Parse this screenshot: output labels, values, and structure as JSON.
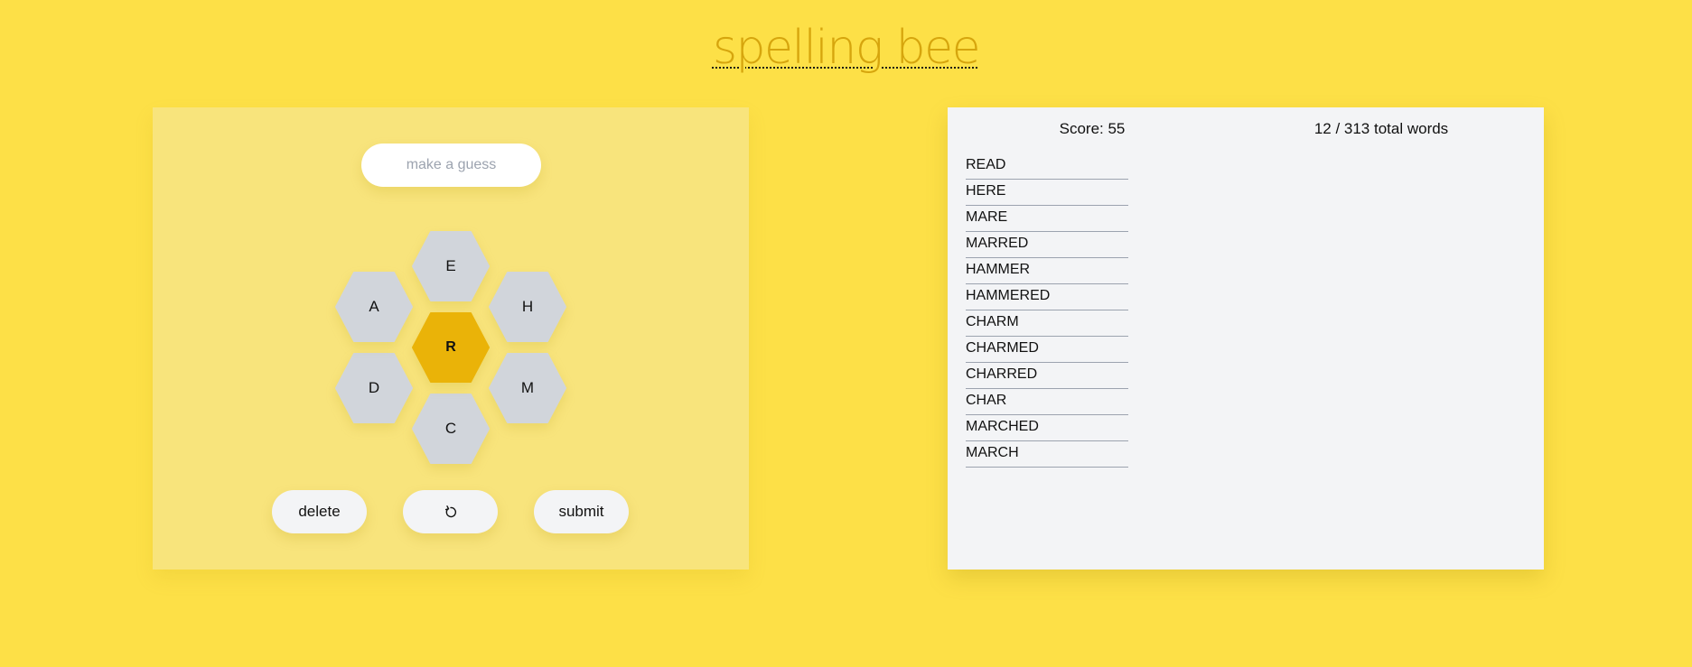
{
  "header": {
    "title": "spelling bee"
  },
  "game": {
    "guess_input": {
      "value": "",
      "placeholder": "make a guess"
    },
    "letters": {
      "center": "R",
      "outer": [
        "E",
        "H",
        "M",
        "C",
        "D",
        "A"
      ]
    },
    "colors": {
      "background": "#fde047",
      "center_hex": "#eab308",
      "outer_hex": "#d1d5db"
    },
    "buttons": {
      "delete_label": "delete",
      "shuffle_icon": "↻",
      "submit_label": "submit"
    }
  },
  "results": {
    "score_label": "Score: 55",
    "score": 55,
    "found_count": 12,
    "total_words": 313,
    "count_label": "12 / 313 total words",
    "words": [
      "READ",
      "HERE",
      "MARE",
      "MARRED",
      "HAMMER",
      "HAMMERED",
      "CHARM",
      "CHARMED",
      "CHARRED",
      "CHAR",
      "MARCHED",
      "MARCH"
    ]
  }
}
